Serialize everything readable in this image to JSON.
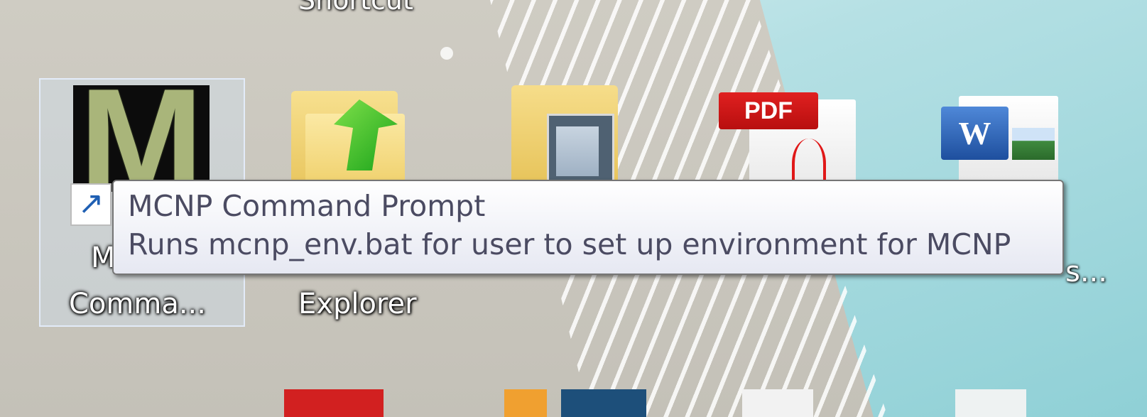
{
  "desktop": {
    "top_label": "Shortcut",
    "icons": [
      {
        "name": "MCNP Command Prompt shortcut",
        "label": "Comma...",
        "label_prefix": "M",
        "letter": "M"
      },
      {
        "name": "Explorer shortcut",
        "label": "Explorer"
      },
      {
        "name": "folder"
      },
      {
        "name": "pdf-file",
        "badge": "PDF"
      },
      {
        "name": "word-document",
        "badge": "W"
      }
    ],
    "partial_label": "s..."
  },
  "tooltip": {
    "title": "MCNP Command Prompt",
    "description": "Runs mcnp_env.bat for user to set up environment for MCNP"
  },
  "colors": {
    "tooltip_text": "#4b4b62",
    "tooltip_border": "#767676",
    "pdf_red": "#d01818",
    "word_blue": "#2d63b8",
    "teal_background": "#8fd0d6"
  }
}
